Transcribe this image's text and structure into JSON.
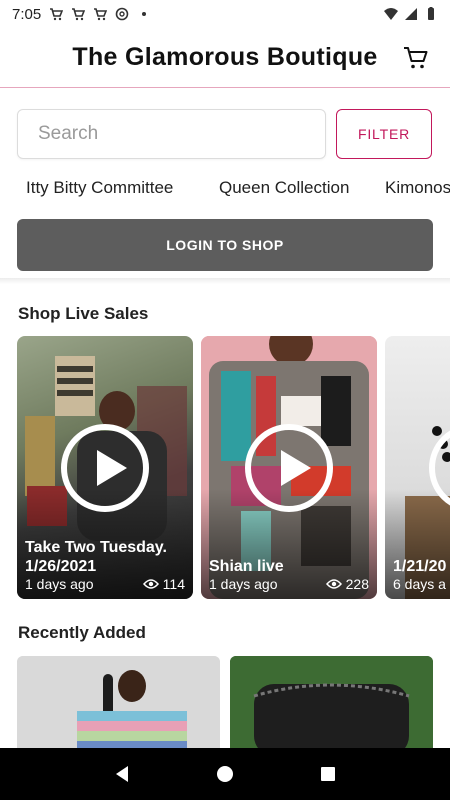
{
  "status_bar": {
    "time": "7:05",
    "icons": [
      "cart-icon",
      "cart-icon",
      "cart-icon",
      "at-icon",
      "dot-icon",
      "wifi-icon",
      "signal-icon",
      "battery-icon"
    ]
  },
  "header": {
    "title": "The Glamorous Boutique",
    "cart_icon": "cart-icon"
  },
  "search": {
    "placeholder": "Search",
    "value": "",
    "filter_label": "FILTER"
  },
  "collections": [
    "Itty Bitty Committee",
    "Queen Collection",
    "Kimonos"
  ],
  "login_button": "LOGIN TO SHOP",
  "sections": {
    "live_sales": "Shop Live Sales",
    "recently_added": "Recently Added"
  },
  "live_sales": [
    {
      "title": "Take Two Tuesday. 1/26/2021",
      "ago": "1 days ago",
      "views": "114"
    },
    {
      "title": "Shian live",
      "ago": "1 days ago",
      "views": "228"
    },
    {
      "title": "1/21/20",
      "ago": "6 days a",
      "views": ""
    }
  ],
  "colors": {
    "accent": "#c2185b",
    "login_bg": "#5d5d5d",
    "header_rule": "#e6a6bd"
  }
}
